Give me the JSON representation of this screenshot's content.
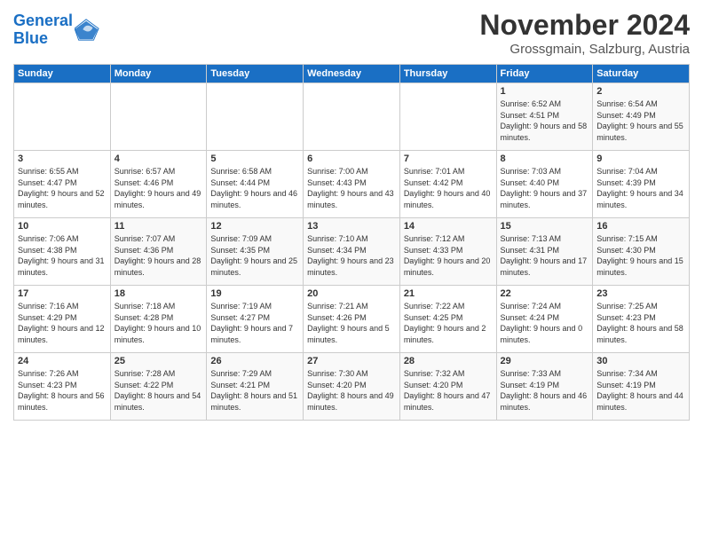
{
  "logo": {
    "line1": "General",
    "line2": "Blue"
  },
  "title": "November 2024",
  "subtitle": "Grossgmain, Salzburg, Austria",
  "days_of_week": [
    "Sunday",
    "Monday",
    "Tuesday",
    "Wednesday",
    "Thursday",
    "Friday",
    "Saturday"
  ],
  "weeks": [
    [
      {
        "day": "",
        "info": ""
      },
      {
        "day": "",
        "info": ""
      },
      {
        "day": "",
        "info": ""
      },
      {
        "day": "",
        "info": ""
      },
      {
        "day": "",
        "info": ""
      },
      {
        "day": "1",
        "info": "Sunrise: 6:52 AM\nSunset: 4:51 PM\nDaylight: 9 hours and 58 minutes."
      },
      {
        "day": "2",
        "info": "Sunrise: 6:54 AM\nSunset: 4:49 PM\nDaylight: 9 hours and 55 minutes."
      }
    ],
    [
      {
        "day": "3",
        "info": "Sunrise: 6:55 AM\nSunset: 4:47 PM\nDaylight: 9 hours and 52 minutes."
      },
      {
        "day": "4",
        "info": "Sunrise: 6:57 AM\nSunset: 4:46 PM\nDaylight: 9 hours and 49 minutes."
      },
      {
        "day": "5",
        "info": "Sunrise: 6:58 AM\nSunset: 4:44 PM\nDaylight: 9 hours and 46 minutes."
      },
      {
        "day": "6",
        "info": "Sunrise: 7:00 AM\nSunset: 4:43 PM\nDaylight: 9 hours and 43 minutes."
      },
      {
        "day": "7",
        "info": "Sunrise: 7:01 AM\nSunset: 4:42 PM\nDaylight: 9 hours and 40 minutes."
      },
      {
        "day": "8",
        "info": "Sunrise: 7:03 AM\nSunset: 4:40 PM\nDaylight: 9 hours and 37 minutes."
      },
      {
        "day": "9",
        "info": "Sunrise: 7:04 AM\nSunset: 4:39 PM\nDaylight: 9 hours and 34 minutes."
      }
    ],
    [
      {
        "day": "10",
        "info": "Sunrise: 7:06 AM\nSunset: 4:38 PM\nDaylight: 9 hours and 31 minutes."
      },
      {
        "day": "11",
        "info": "Sunrise: 7:07 AM\nSunset: 4:36 PM\nDaylight: 9 hours and 28 minutes."
      },
      {
        "day": "12",
        "info": "Sunrise: 7:09 AM\nSunset: 4:35 PM\nDaylight: 9 hours and 25 minutes."
      },
      {
        "day": "13",
        "info": "Sunrise: 7:10 AM\nSunset: 4:34 PM\nDaylight: 9 hours and 23 minutes."
      },
      {
        "day": "14",
        "info": "Sunrise: 7:12 AM\nSunset: 4:33 PM\nDaylight: 9 hours and 20 minutes."
      },
      {
        "day": "15",
        "info": "Sunrise: 7:13 AM\nSunset: 4:31 PM\nDaylight: 9 hours and 17 minutes."
      },
      {
        "day": "16",
        "info": "Sunrise: 7:15 AM\nSunset: 4:30 PM\nDaylight: 9 hours and 15 minutes."
      }
    ],
    [
      {
        "day": "17",
        "info": "Sunrise: 7:16 AM\nSunset: 4:29 PM\nDaylight: 9 hours and 12 minutes."
      },
      {
        "day": "18",
        "info": "Sunrise: 7:18 AM\nSunset: 4:28 PM\nDaylight: 9 hours and 10 minutes."
      },
      {
        "day": "19",
        "info": "Sunrise: 7:19 AM\nSunset: 4:27 PM\nDaylight: 9 hours and 7 minutes."
      },
      {
        "day": "20",
        "info": "Sunrise: 7:21 AM\nSunset: 4:26 PM\nDaylight: 9 hours and 5 minutes."
      },
      {
        "day": "21",
        "info": "Sunrise: 7:22 AM\nSunset: 4:25 PM\nDaylight: 9 hours and 2 minutes."
      },
      {
        "day": "22",
        "info": "Sunrise: 7:24 AM\nSunset: 4:24 PM\nDaylight: 9 hours and 0 minutes."
      },
      {
        "day": "23",
        "info": "Sunrise: 7:25 AM\nSunset: 4:23 PM\nDaylight: 8 hours and 58 minutes."
      }
    ],
    [
      {
        "day": "24",
        "info": "Sunrise: 7:26 AM\nSunset: 4:23 PM\nDaylight: 8 hours and 56 minutes."
      },
      {
        "day": "25",
        "info": "Sunrise: 7:28 AM\nSunset: 4:22 PM\nDaylight: 8 hours and 54 minutes."
      },
      {
        "day": "26",
        "info": "Sunrise: 7:29 AM\nSunset: 4:21 PM\nDaylight: 8 hours and 51 minutes."
      },
      {
        "day": "27",
        "info": "Sunrise: 7:30 AM\nSunset: 4:20 PM\nDaylight: 8 hours and 49 minutes."
      },
      {
        "day": "28",
        "info": "Sunrise: 7:32 AM\nSunset: 4:20 PM\nDaylight: 8 hours and 47 minutes."
      },
      {
        "day": "29",
        "info": "Sunrise: 7:33 AM\nSunset: 4:19 PM\nDaylight: 8 hours and 46 minutes."
      },
      {
        "day": "30",
        "info": "Sunrise: 7:34 AM\nSunset: 4:19 PM\nDaylight: 8 hours and 44 minutes."
      }
    ]
  ]
}
